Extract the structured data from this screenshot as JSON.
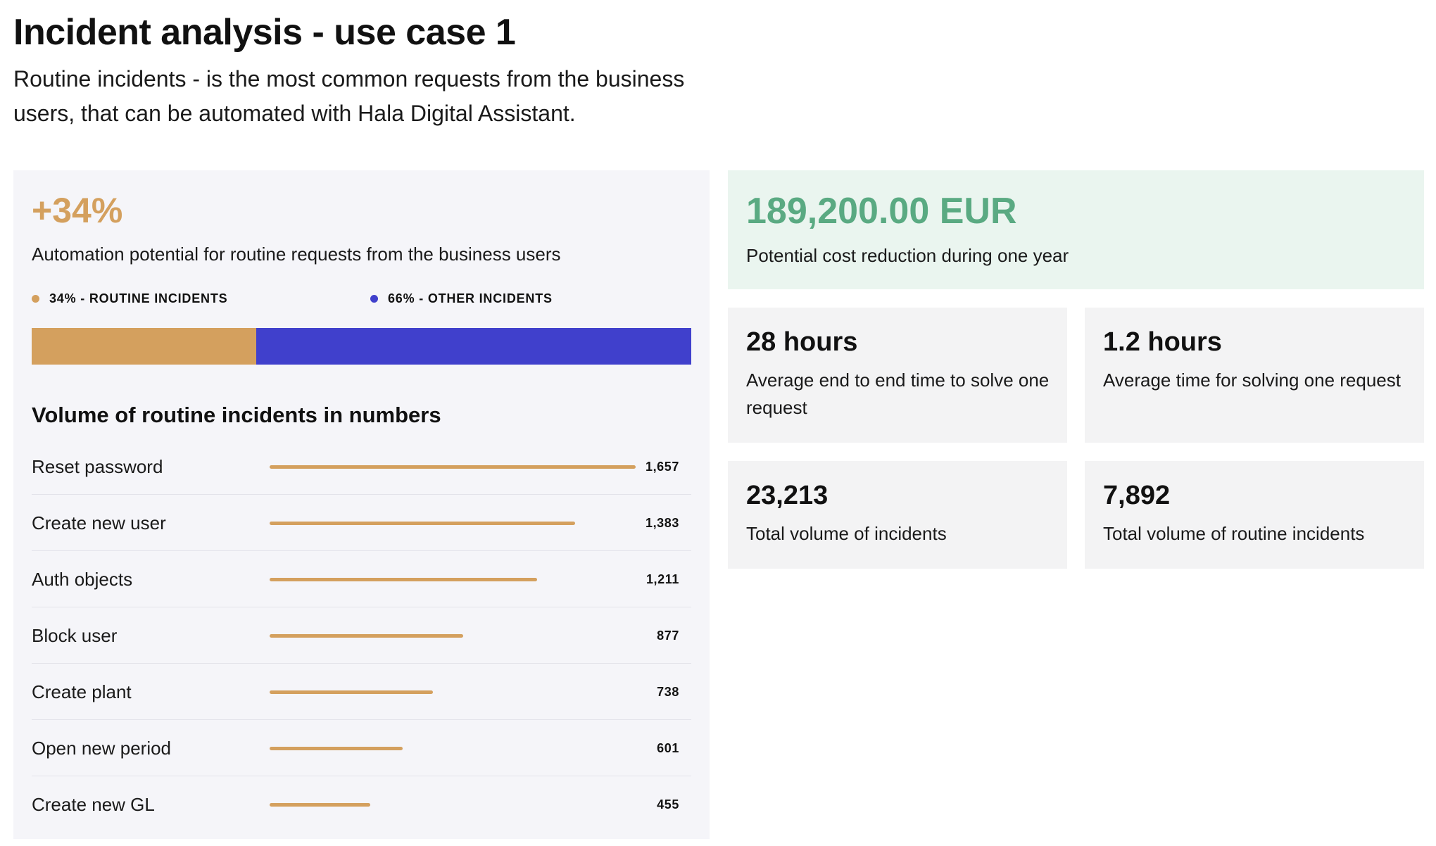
{
  "header": {
    "title": "Incident analysis - use case 1",
    "subtitle": "Routine incidents - is the most common requests from the business users, that can be automated with Hala Digital Assistant."
  },
  "automation": {
    "headline": "+34%",
    "description": "Automation potential for routine requests from the business users",
    "legend": [
      {
        "label": "34% - ROUTINE INCIDENTS",
        "color": "#d4a05e"
      },
      {
        "label": "66% - OTHER INCIDENTS",
        "color": "#4040cc"
      }
    ],
    "split": [
      {
        "share": 34,
        "color": "#d4a05e"
      },
      {
        "share": 66,
        "color": "#4040cc"
      }
    ]
  },
  "volume": {
    "title": "Volume of routine incidents in numbers",
    "max": 1657,
    "items": [
      {
        "label": "Reset password",
        "value": 1657,
        "display": "1,657"
      },
      {
        "label": "Create new user",
        "value": 1383,
        "display": "1,383"
      },
      {
        "label": "Auth objects",
        "value": 1211,
        "display": "1,211"
      },
      {
        "label": "Block user",
        "value": 877,
        "display": "877"
      },
      {
        "label": "Create plant",
        "value": 738,
        "display": "738"
      },
      {
        "label": "Open new period",
        "value": 601,
        "display": "601"
      },
      {
        "label": "Create new GL",
        "value": 455,
        "display": "455"
      }
    ]
  },
  "cost": {
    "value": "189,200.00 EUR",
    "description": "Potential cost reduction during one year"
  },
  "stats": [
    {
      "value": "28 hours",
      "description": "Average end to end time to solve one request"
    },
    {
      "value": "1.2 hours",
      "description": "Average time for solving one request"
    },
    {
      "value": "23,213",
      "description": "Total volume of incidents"
    },
    {
      "value": "7,892",
      "description": "Total volume of routine incidents"
    }
  ],
  "colors": {
    "routine": "#d4a05e",
    "other": "#4040cc",
    "cost_accent": "#5aaa82"
  }
}
